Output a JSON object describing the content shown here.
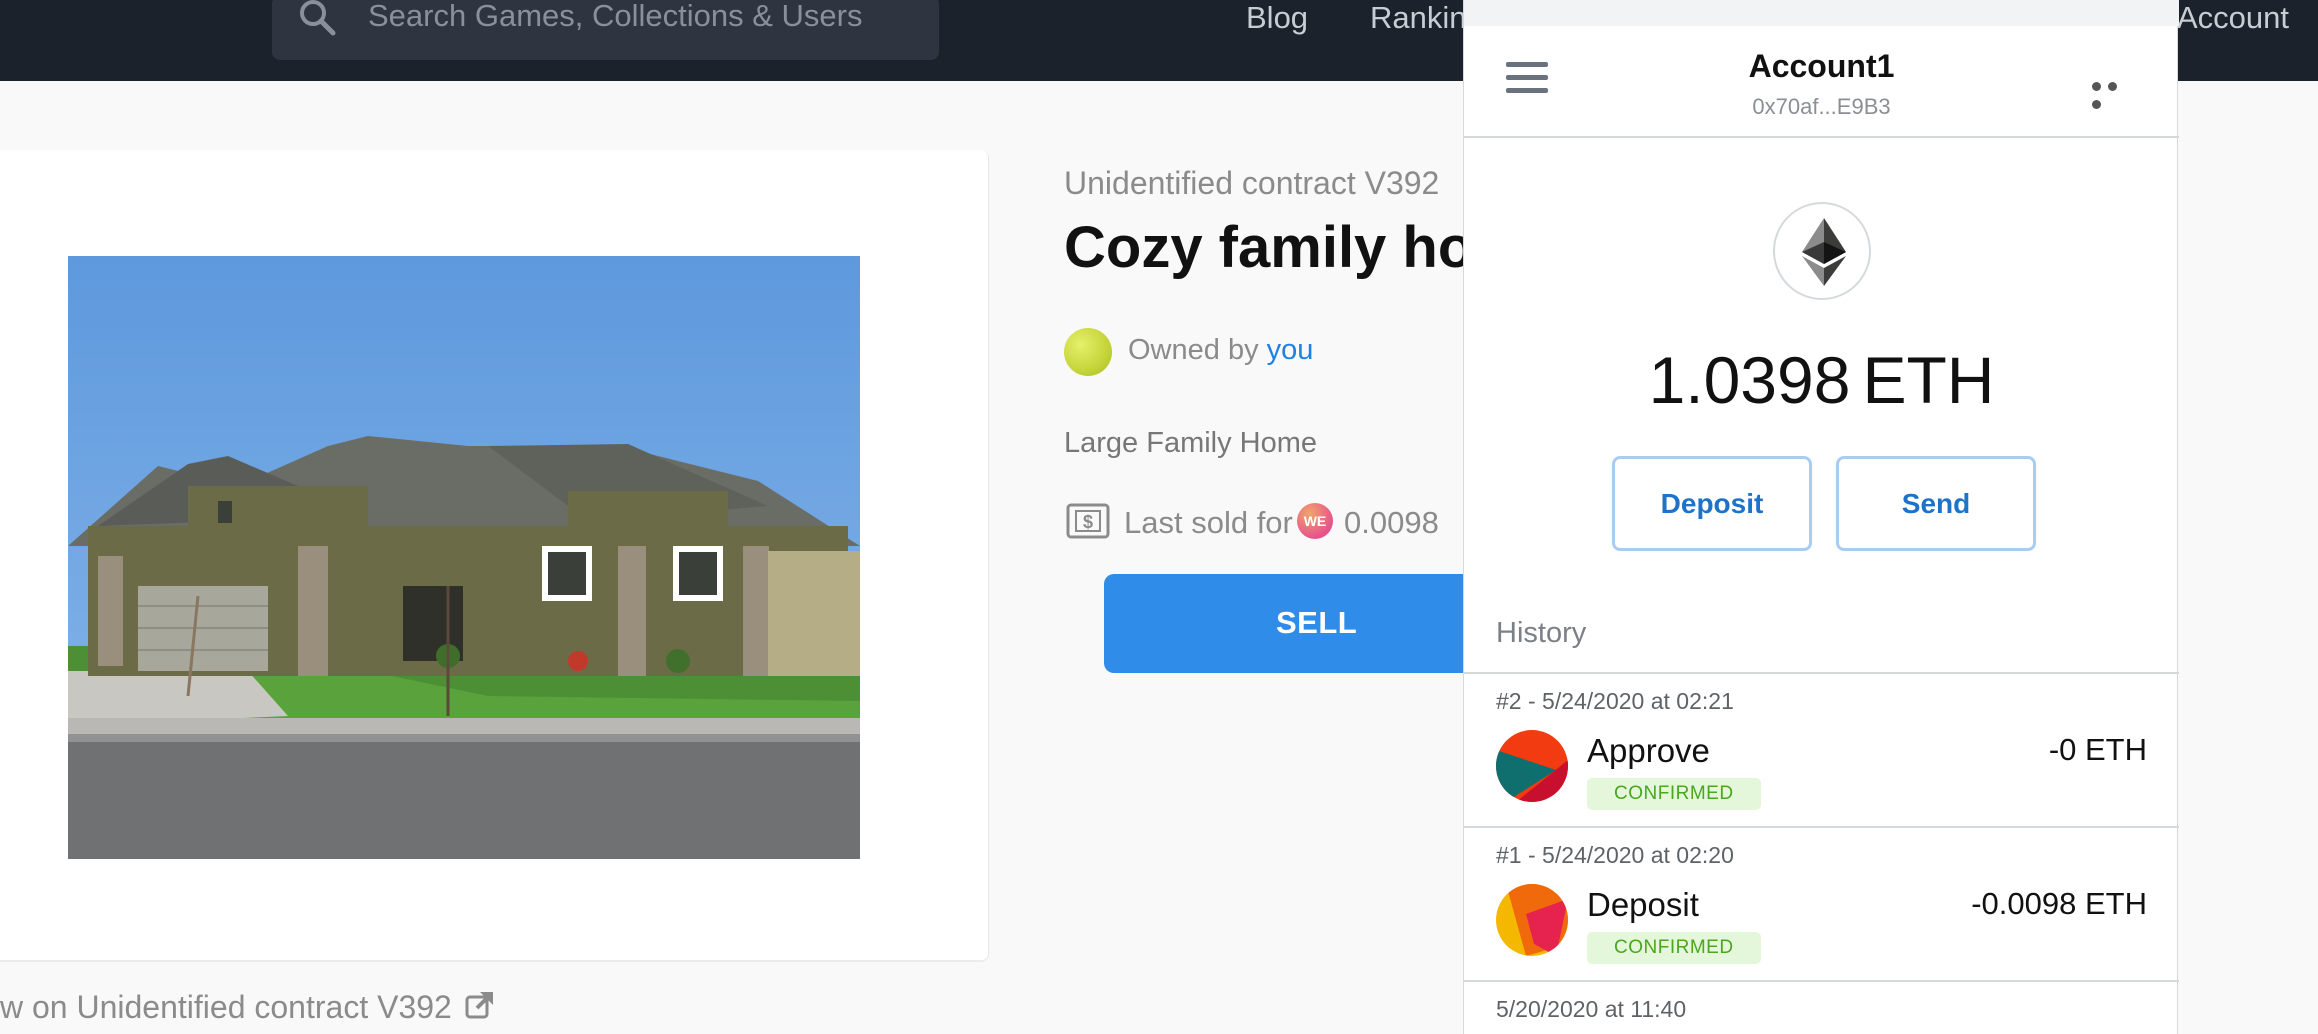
{
  "nav": {
    "search_placeholder": "Search Games, Collections & Users",
    "links": [
      "Blog",
      "Ranking",
      "Account"
    ]
  },
  "item": {
    "contract": "Unidentified contract V392",
    "title": "Cozy family hor",
    "owned_by": "Owned by",
    "owner": "you",
    "description": "Large Family Home",
    "last_sold_label": "Last sold for",
    "token_symbol": "WE",
    "last_price": "0.0098",
    "sell_label": "SELL",
    "view_on": "w on Unidentified contract V392"
  },
  "wallet": {
    "account_name": "Account1",
    "address": "0x70af...E9B3",
    "balance_amount": "1.0398",
    "balance_unit": "ETH",
    "deposit_label": "Deposit",
    "send_label": "Send",
    "history_label": "History",
    "transactions": [
      {
        "meta": "#2 - 5/24/2020 at 02:21",
        "title": "Approve",
        "status": "CONFIRMED",
        "amount": "-0 ETH"
      },
      {
        "meta": "#1 - 5/24/2020 at 02:20",
        "title": "Deposit",
        "status": "CONFIRMED",
        "amount": "-0.0098 ETH"
      },
      {
        "meta": "5/20/2020 at 11:40"
      }
    ]
  },
  "colors": {
    "nav_bg": "#1c222c",
    "accent_blue": "#2f8ce8",
    "link_blue": "#2081e2",
    "confirmed_green": "#4aa71e"
  }
}
